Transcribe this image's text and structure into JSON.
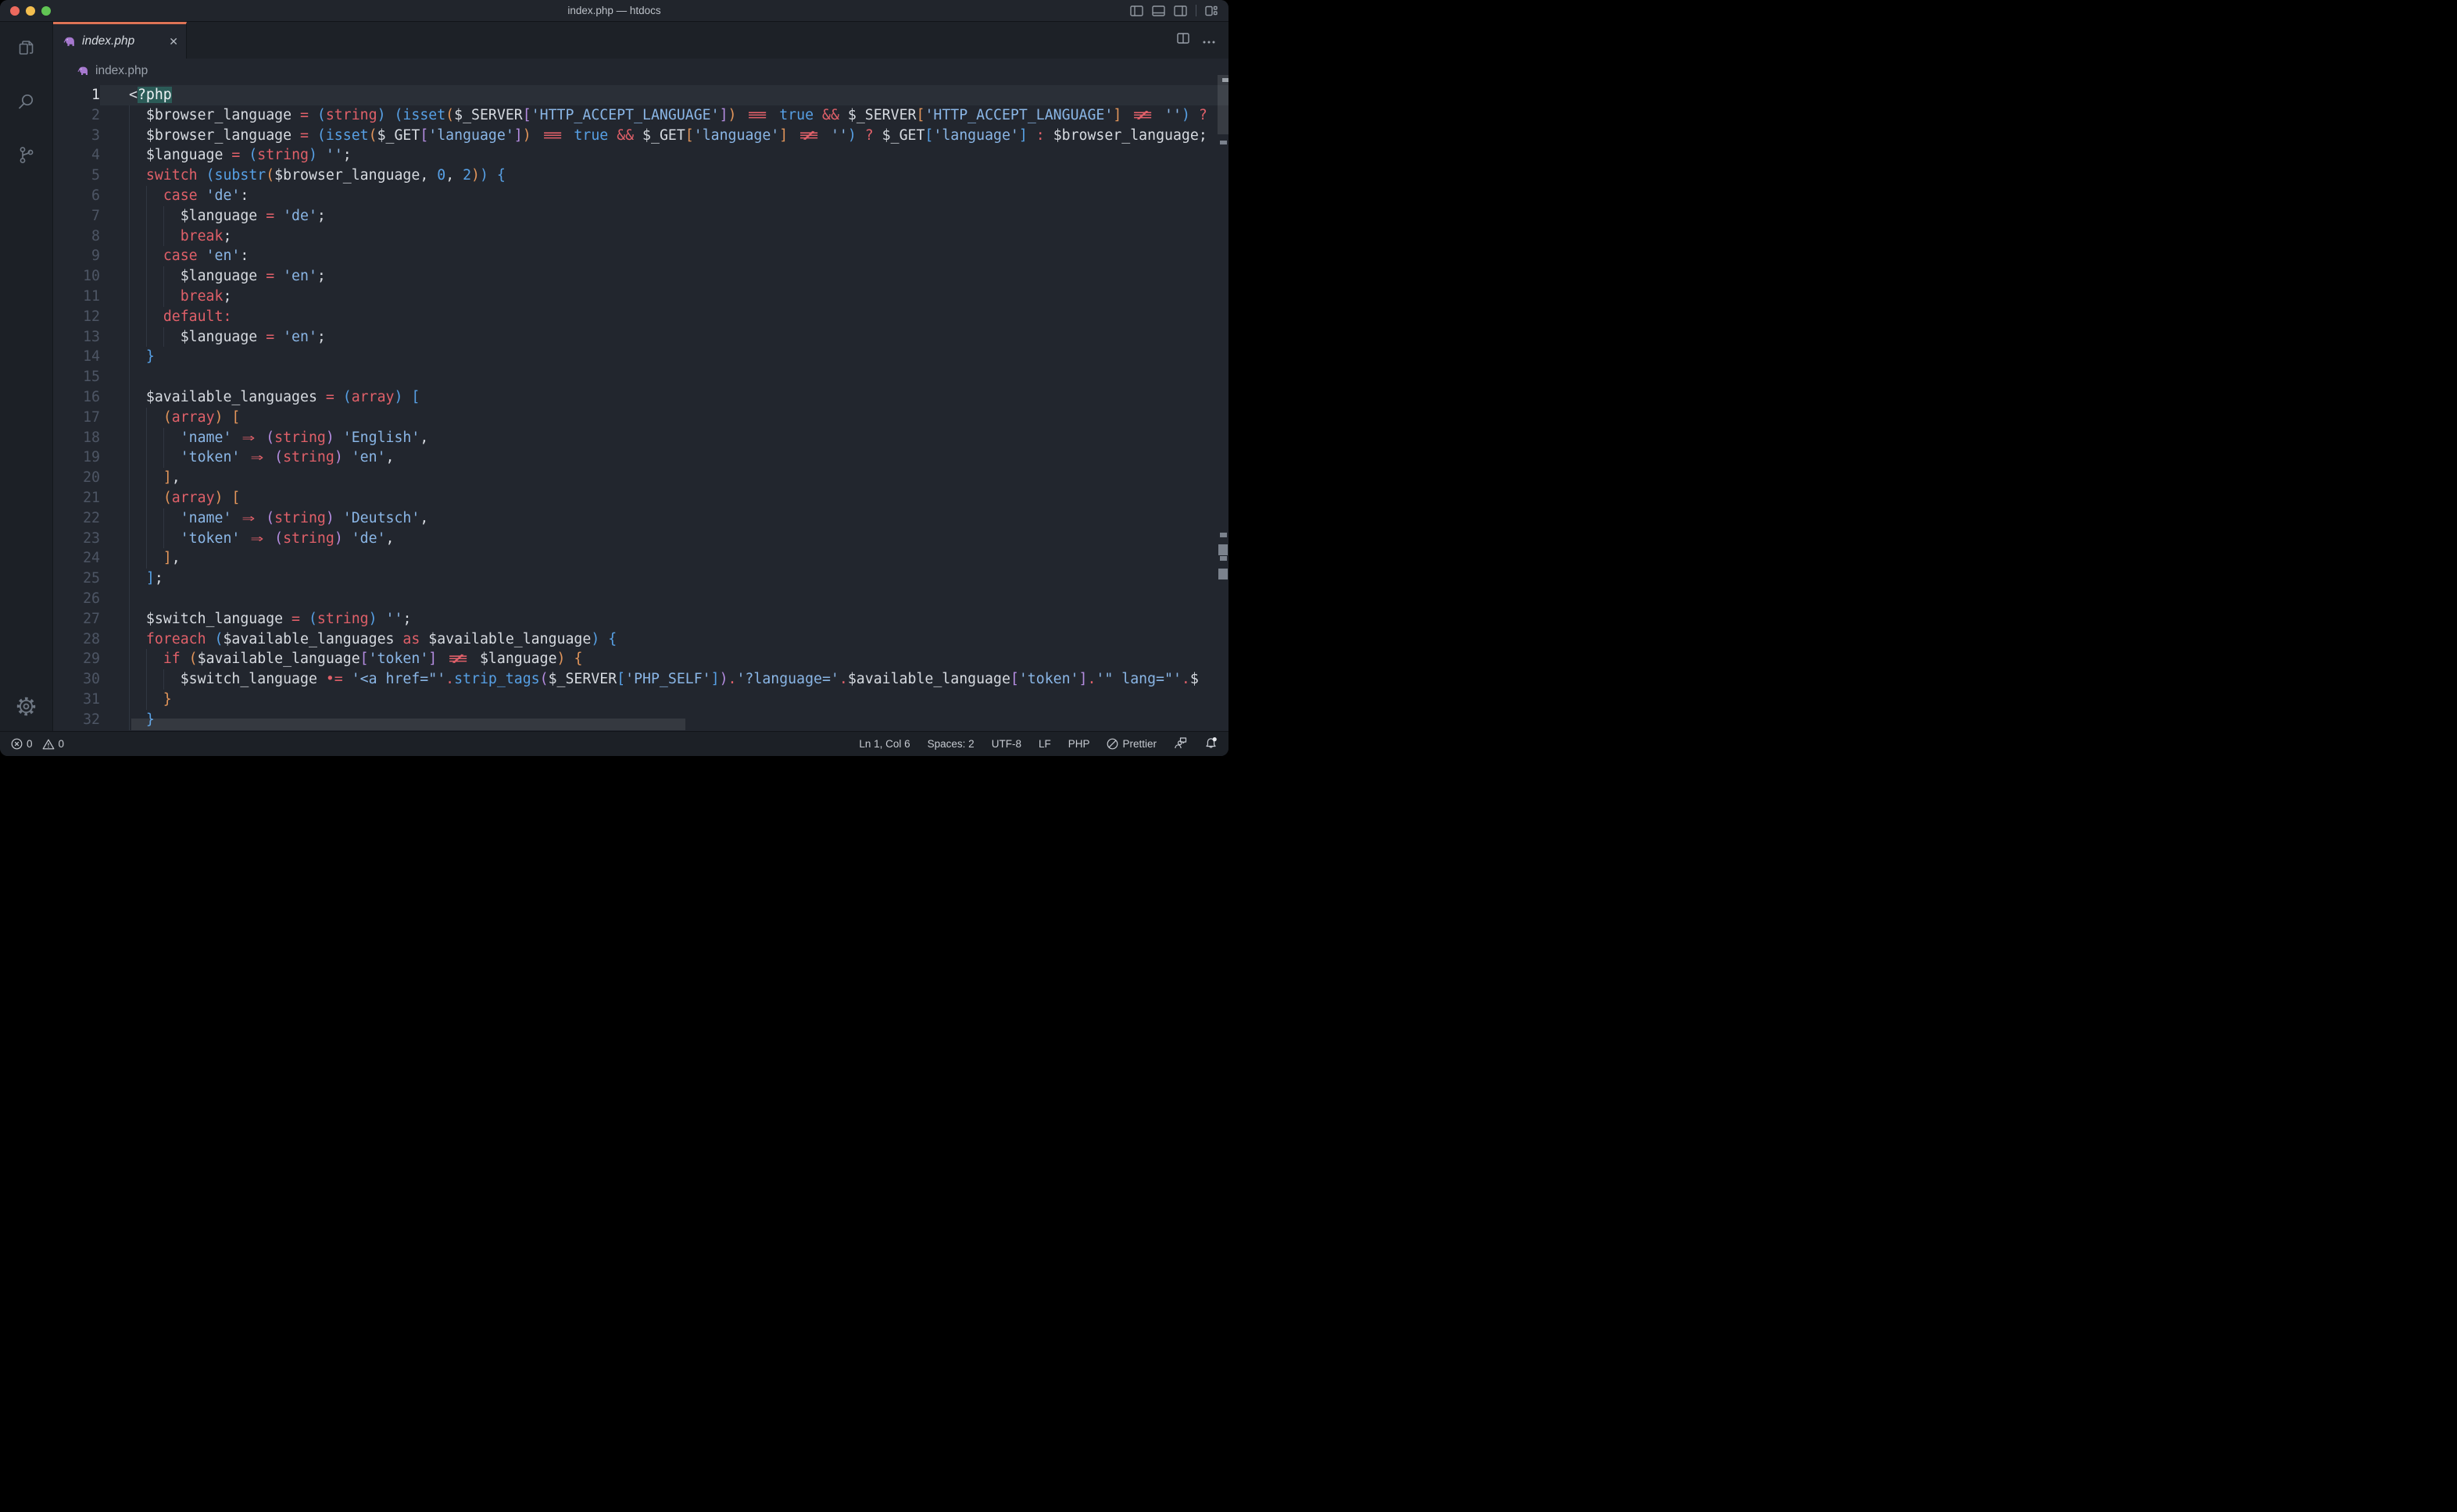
{
  "window": {
    "title": "index.php — htdocs"
  },
  "tab": {
    "label": "index.php",
    "close_glyph": "✕"
  },
  "breadcrumb": {
    "file": "index.php"
  },
  "colors": {
    "accent_tab_border": "#dd7356",
    "selection_teal": "#2b5b57",
    "editor_background": "#22262e",
    "chrome_background": "#1c2026",
    "keyword_red": "#e06069",
    "function_blue": "#57a0e5",
    "string_blue": "#8ab6e6",
    "bracket_orange": "#e2955a",
    "bracket_purple": "#b48ce0",
    "php_icon_purple": "#a678cf",
    "traffic_red": "#ed6a5e",
    "traffic_yellow": "#f4bf4f",
    "traffic_green": "#61c554"
  },
  "editor": {
    "lines": [
      {
        "n": "1",
        "cur": true,
        "t": [
          [
            "v",
            "<"
          ],
          [
            "hl",
            "?php"
          ]
        ]
      },
      {
        "n": "2",
        "t": [
          [
            "v",
            "  $browser_language"
          ],
          [
            "k",
            " = "
          ],
          [
            "b1",
            "("
          ],
          [
            "k",
            "string"
          ],
          [
            "b1",
            ")"
          ],
          [
            "p",
            " "
          ],
          [
            "b1",
            "("
          ],
          [
            "f",
            "isset"
          ],
          [
            "b2",
            "("
          ],
          [
            "v",
            "$_SERVER"
          ],
          [
            "b3",
            "["
          ],
          [
            "s",
            "'HTTP_ACCEPT_LANGUAGE'"
          ],
          [
            "b3",
            "]"
          ],
          [
            "b2",
            ")"
          ],
          [
            "p",
            " "
          ],
          [
            "k3",
            "≡"
          ],
          [
            "p",
            " "
          ],
          [
            "n",
            "true"
          ],
          [
            "p",
            " "
          ],
          [
            "k",
            "&&"
          ],
          [
            "p",
            " "
          ],
          [
            "v",
            "$_SERVER"
          ],
          [
            "b2",
            "["
          ],
          [
            "s",
            "'HTTP_ACCEPT_LANGUAGE'"
          ],
          [
            "b2",
            "]"
          ],
          [
            "p",
            " "
          ],
          [
            "k3",
            "≢"
          ],
          [
            "p",
            " "
          ],
          [
            "s",
            "''"
          ],
          [
            "b1",
            ")"
          ],
          [
            "p",
            " "
          ],
          [
            "k",
            "?"
          ]
        ]
      },
      {
        "n": "3",
        "t": [
          [
            "v",
            "  $browser_language"
          ],
          [
            "k",
            " = "
          ],
          [
            "b1",
            "("
          ],
          [
            "f",
            "isset"
          ],
          [
            "b2",
            "("
          ],
          [
            "v",
            "$_GET"
          ],
          [
            "b3",
            "["
          ],
          [
            "s",
            "'language'"
          ],
          [
            "b3",
            "]"
          ],
          [
            "b2",
            ")"
          ],
          [
            "p",
            " "
          ],
          [
            "k3",
            "≡"
          ],
          [
            "p",
            " "
          ],
          [
            "n",
            "true"
          ],
          [
            "p",
            " "
          ],
          [
            "k",
            "&&"
          ],
          [
            "p",
            " "
          ],
          [
            "v",
            "$_GET"
          ],
          [
            "b2",
            "["
          ],
          [
            "s",
            "'language'"
          ],
          [
            "b2",
            "]"
          ],
          [
            "p",
            " "
          ],
          [
            "k3",
            "≢"
          ],
          [
            "p",
            " "
          ],
          [
            "s",
            "''"
          ],
          [
            "b1",
            ")"
          ],
          [
            "p",
            " "
          ],
          [
            "k",
            "?"
          ],
          [
            "p",
            " "
          ],
          [
            "v",
            "$_GET"
          ],
          [
            "b1",
            "["
          ],
          [
            "s",
            "'language'"
          ],
          [
            "b1",
            "]"
          ],
          [
            "p",
            " "
          ],
          [
            "k",
            ":"
          ],
          [
            "p",
            " "
          ],
          [
            "v",
            "$browser_language"
          ],
          [
            "p",
            ";"
          ]
        ]
      },
      {
        "n": "4",
        "t": [
          [
            "v",
            "  $language"
          ],
          [
            "k",
            " = "
          ],
          [
            "b1",
            "("
          ],
          [
            "k",
            "string"
          ],
          [
            "b1",
            ")"
          ],
          [
            "p",
            " "
          ],
          [
            "s",
            "''"
          ],
          [
            "p",
            ";"
          ]
        ]
      },
      {
        "n": "5",
        "t": [
          [
            "p",
            "  "
          ],
          [
            "k",
            "switch"
          ],
          [
            "p",
            " "
          ],
          [
            "b1",
            "("
          ],
          [
            "f",
            "substr"
          ],
          [
            "b2",
            "("
          ],
          [
            "v",
            "$browser_language"
          ],
          [
            "p",
            ", "
          ],
          [
            "n",
            "0"
          ],
          [
            "p",
            ", "
          ],
          [
            "n",
            "2"
          ],
          [
            "b2",
            ")"
          ],
          [
            "b1",
            ")"
          ],
          [
            "p",
            " "
          ],
          [
            "b1",
            "{"
          ]
        ]
      },
      {
        "n": "6",
        "t": [
          [
            "p",
            "    "
          ],
          [
            "k",
            "case"
          ],
          [
            "p",
            " "
          ],
          [
            "s",
            "'de'"
          ],
          [
            "p",
            ":"
          ]
        ]
      },
      {
        "n": "7",
        "t": [
          [
            "v",
            "      $language"
          ],
          [
            "k",
            " = "
          ],
          [
            "s",
            "'de'"
          ],
          [
            "p",
            ";"
          ]
        ]
      },
      {
        "n": "8",
        "t": [
          [
            "p",
            "      "
          ],
          [
            "k",
            "break"
          ],
          [
            "p",
            ";"
          ]
        ]
      },
      {
        "n": "9",
        "t": [
          [
            "p",
            "    "
          ],
          [
            "k",
            "case"
          ],
          [
            "p",
            " "
          ],
          [
            "s",
            "'en'"
          ],
          [
            "p",
            ":"
          ]
        ]
      },
      {
        "n": "10",
        "t": [
          [
            "v",
            "      $language"
          ],
          [
            "k",
            " = "
          ],
          [
            "s",
            "'en'"
          ],
          [
            "p",
            ";"
          ]
        ]
      },
      {
        "n": "11",
        "t": [
          [
            "p",
            "      "
          ],
          [
            "k",
            "break"
          ],
          [
            "p",
            ";"
          ]
        ]
      },
      {
        "n": "12",
        "t": [
          [
            "p",
            "    "
          ],
          [
            "k",
            "default:"
          ]
        ]
      },
      {
        "n": "13",
        "t": [
          [
            "v",
            "      $language"
          ],
          [
            "k",
            " = "
          ],
          [
            "s",
            "'en'"
          ],
          [
            "p",
            ";"
          ]
        ]
      },
      {
        "n": "14",
        "t": [
          [
            "b1",
            "  }"
          ]
        ]
      },
      {
        "n": "15",
        "ind": 2,
        "t": []
      },
      {
        "n": "16",
        "t": [
          [
            "v",
            "  $available_languages"
          ],
          [
            "k",
            " = "
          ],
          [
            "b1",
            "("
          ],
          [
            "k",
            "array"
          ],
          [
            "b1",
            ")"
          ],
          [
            "p",
            " "
          ],
          [
            "b1",
            "["
          ]
        ]
      },
      {
        "n": "17",
        "t": [
          [
            "p",
            "    "
          ],
          [
            "b2",
            "("
          ],
          [
            "k",
            "array"
          ],
          [
            "b2",
            ")"
          ],
          [
            "p",
            " "
          ],
          [
            "b2",
            "["
          ]
        ]
      },
      {
        "n": "18",
        "t": [
          [
            "p",
            "      "
          ],
          [
            "s",
            "'name'"
          ],
          [
            "p",
            " "
          ],
          [
            "arr",
            "⇒"
          ],
          [
            "p",
            " "
          ],
          [
            "b3",
            "("
          ],
          [
            "k",
            "string"
          ],
          [
            "b3",
            ")"
          ],
          [
            "p",
            " "
          ],
          [
            "s",
            "'English'"
          ],
          [
            "p",
            ","
          ]
        ]
      },
      {
        "n": "19",
        "t": [
          [
            "p",
            "      "
          ],
          [
            "s",
            "'token'"
          ],
          [
            "p",
            " "
          ],
          [
            "arr",
            "⇒"
          ],
          [
            "p",
            " "
          ],
          [
            "b3",
            "("
          ],
          [
            "k",
            "string"
          ],
          [
            "b3",
            ")"
          ],
          [
            "p",
            " "
          ],
          [
            "s",
            "'en'"
          ],
          [
            "p",
            ","
          ]
        ]
      },
      {
        "n": "20",
        "t": [
          [
            "b2",
            "    ]"
          ],
          [
            "p",
            ","
          ]
        ]
      },
      {
        "n": "21",
        "t": [
          [
            "p",
            "    "
          ],
          [
            "b2",
            "("
          ],
          [
            "k",
            "array"
          ],
          [
            "b2",
            ")"
          ],
          [
            "p",
            " "
          ],
          [
            "b2",
            "["
          ]
        ]
      },
      {
        "n": "22",
        "t": [
          [
            "p",
            "      "
          ],
          [
            "s",
            "'name'"
          ],
          [
            "p",
            " "
          ],
          [
            "arr",
            "⇒"
          ],
          [
            "p",
            " "
          ],
          [
            "b3",
            "("
          ],
          [
            "k",
            "string"
          ],
          [
            "b3",
            ")"
          ],
          [
            "p",
            " "
          ],
          [
            "s",
            "'Deutsch'"
          ],
          [
            "p",
            ","
          ]
        ]
      },
      {
        "n": "23",
        "t": [
          [
            "p",
            "      "
          ],
          [
            "s",
            "'token'"
          ],
          [
            "p",
            " "
          ],
          [
            "arr",
            "⇒"
          ],
          [
            "p",
            " "
          ],
          [
            "b3",
            "("
          ],
          [
            "k",
            "string"
          ],
          [
            "b3",
            ")"
          ],
          [
            "p",
            " "
          ],
          [
            "s",
            "'de'"
          ],
          [
            "p",
            ","
          ]
        ]
      },
      {
        "n": "24",
        "t": [
          [
            "b2",
            "    ]"
          ],
          [
            "p",
            ","
          ]
        ]
      },
      {
        "n": "25",
        "t": [
          [
            "b1",
            "  ]"
          ],
          [
            "p",
            ";"
          ]
        ]
      },
      {
        "n": "26",
        "ind": 2,
        "t": []
      },
      {
        "n": "27",
        "t": [
          [
            "v",
            "  $switch_language"
          ],
          [
            "k",
            " = "
          ],
          [
            "b1",
            "("
          ],
          [
            "k",
            "string"
          ],
          [
            "b1",
            ")"
          ],
          [
            "p",
            " "
          ],
          [
            "s",
            "''"
          ],
          [
            "p",
            ";"
          ]
        ]
      },
      {
        "n": "28",
        "t": [
          [
            "p",
            "  "
          ],
          [
            "k",
            "foreach"
          ],
          [
            "p",
            " "
          ],
          [
            "b1",
            "("
          ],
          [
            "v",
            "$available_languages"
          ],
          [
            "p",
            " "
          ],
          [
            "k",
            "as"
          ],
          [
            "p",
            " "
          ],
          [
            "v",
            "$available_language"
          ],
          [
            "b1",
            ")"
          ],
          [
            "p",
            " "
          ],
          [
            "b1",
            "{"
          ]
        ]
      },
      {
        "n": "29",
        "t": [
          [
            "p",
            "    "
          ],
          [
            "k",
            "if"
          ],
          [
            "p",
            " "
          ],
          [
            "b2",
            "("
          ],
          [
            "v",
            "$available_language"
          ],
          [
            "b3",
            "["
          ],
          [
            "s",
            "'token'"
          ],
          [
            "b3",
            "]"
          ],
          [
            "p",
            " "
          ],
          [
            "k3",
            "≢"
          ],
          [
            "p",
            " "
          ],
          [
            "v",
            "$language"
          ],
          [
            "b2",
            ")"
          ],
          [
            "p",
            " "
          ],
          [
            "b2",
            "{"
          ]
        ]
      },
      {
        "n": "30",
        "t": [
          [
            "v",
            "      $switch_language"
          ],
          [
            "p",
            " "
          ],
          [
            "k2",
            "•="
          ],
          [
            "p",
            " "
          ],
          [
            "s",
            "'<a href=\"'"
          ],
          [
            "k",
            "."
          ],
          [
            "f",
            "strip_tags"
          ],
          [
            "b3",
            "("
          ],
          [
            "v",
            "$_SERVER"
          ],
          [
            "b1",
            "["
          ],
          [
            "s",
            "'PHP_SELF'"
          ],
          [
            "b1",
            "]"
          ],
          [
            "b3",
            ")"
          ],
          [
            "k",
            "."
          ],
          [
            "s",
            "'?language='"
          ],
          [
            "k",
            "."
          ],
          [
            "v",
            "$available_language"
          ],
          [
            "b3",
            "["
          ],
          [
            "s",
            "'token'"
          ],
          [
            "b3",
            "]"
          ],
          [
            "k",
            "."
          ],
          [
            "s",
            "'\" lang=\"'"
          ],
          [
            "k",
            "."
          ],
          [
            "v",
            "$"
          ]
        ]
      },
      {
        "n": "31",
        "t": [
          [
            "b2",
            "    }"
          ]
        ]
      },
      {
        "n": "32",
        "t": [
          [
            "b1",
            "  }"
          ]
        ]
      }
    ]
  },
  "status_bar": {
    "errors": "0",
    "warnings": "0",
    "line_col": "Ln 1, Col 6",
    "indentation": "Spaces: 2",
    "encoding": "UTF-8",
    "eol": "LF",
    "language": "PHP",
    "formatter": "Prettier"
  }
}
